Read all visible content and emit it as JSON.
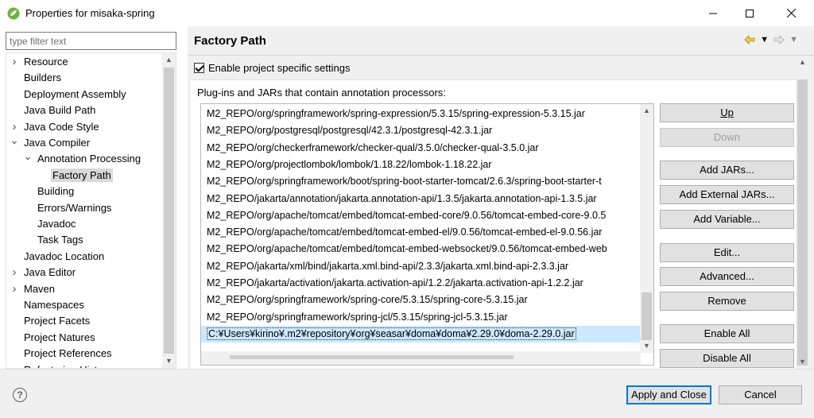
{
  "window": {
    "title": "Properties for misaka-spring",
    "minimize_icon": "minimize-icon",
    "maximize_icon": "maximize-icon",
    "close_icon": "close-icon"
  },
  "filter": {
    "placeholder": "type filter text"
  },
  "tree": {
    "items": [
      {
        "label": "Resource",
        "level": 0,
        "arrow": "right"
      },
      {
        "label": "Builders",
        "level": 0,
        "arrow": ""
      },
      {
        "label": "Deployment Assembly",
        "level": 0,
        "arrow": ""
      },
      {
        "label": "Java Build Path",
        "level": 0,
        "arrow": ""
      },
      {
        "label": "Java Code Style",
        "level": 0,
        "arrow": "right"
      },
      {
        "label": "Java Compiler",
        "level": 0,
        "arrow": "down"
      },
      {
        "label": "Annotation Processing",
        "level": 1,
        "arrow": "down"
      },
      {
        "label": "Factory Path",
        "level": 2,
        "arrow": "",
        "selected": true
      },
      {
        "label": "Building",
        "level": 1,
        "arrow": ""
      },
      {
        "label": "Errors/Warnings",
        "level": 1,
        "arrow": ""
      },
      {
        "label": "Javadoc",
        "level": 1,
        "arrow": ""
      },
      {
        "label": "Task Tags",
        "level": 1,
        "arrow": ""
      },
      {
        "label": "Javadoc Location",
        "level": 0,
        "arrow": ""
      },
      {
        "label": "Java Editor",
        "level": 0,
        "arrow": "right"
      },
      {
        "label": "Maven",
        "level": 0,
        "arrow": "right"
      },
      {
        "label": "Namespaces",
        "level": 0,
        "arrow": ""
      },
      {
        "label": "Project Facets",
        "level": 0,
        "arrow": ""
      },
      {
        "label": "Project Natures",
        "level": 0,
        "arrow": ""
      },
      {
        "label": "Project References",
        "level": 0,
        "arrow": ""
      },
      {
        "label": "Refactoring History",
        "level": 0,
        "arrow": ""
      }
    ]
  },
  "page": {
    "title": "Factory Path",
    "enable_label": "Enable project specific settings",
    "enable_checked": true,
    "section_label": "Plug-ins and JARs that contain annotation processors:"
  },
  "jars": [
    "M2_REPO/org/springframework/spring-expression/5.3.15/spring-expression-5.3.15.jar",
    "M2_REPO/org/postgresql/postgresql/42.3.1/postgresql-42.3.1.jar",
    "M2_REPO/org/checkerframework/checker-qual/3.5.0/checker-qual-3.5.0.jar",
    "M2_REPO/org/projectlombok/lombok/1.18.22/lombok-1.18.22.jar",
    "M2_REPO/org/springframework/boot/spring-boot-starter-tomcat/2.6.3/spring-boot-starter-t",
    "M2_REPO/jakarta/annotation/jakarta.annotation-api/1.3.5/jakarta.annotation-api-1.3.5.jar",
    "M2_REPO/org/apache/tomcat/embed/tomcat-embed-core/9.0.56/tomcat-embed-core-9.0.5",
    "M2_REPO/org/apache/tomcat/embed/tomcat-embed-el/9.0.56/tomcat-embed-el-9.0.56.jar",
    "M2_REPO/org/apache/tomcat/embed/tomcat-embed-websocket/9.0.56/tomcat-embed-web",
    "M2_REPO/jakarta/xml/bind/jakarta.xml.bind-api/2.3.3/jakarta.xml.bind-api-2.3.3.jar",
    "M2_REPO/jakarta/activation/jakarta.activation-api/1.2.2/jakarta.activation-api-1.2.2.jar",
    "M2_REPO/org/springframework/spring-core/5.3.15/spring-core-5.3.15.jar",
    "M2_REPO/org/springframework/spring-jcl/5.3.15/spring-jcl-5.3.15.jar",
    "C:¥Users¥kirino¥.m2¥repository¥org¥seasar¥doma¥doma¥2.29.0¥doma-2.29.0.jar"
  ],
  "selected_jar_index": 13,
  "buttons": {
    "up": "Up",
    "down": "Down",
    "add_jars": "Add JARs...",
    "add_external_jars": "Add External JARs...",
    "add_variable": "Add Variable...",
    "edit": "Edit...",
    "advanced": "Advanced...",
    "remove": "Remove",
    "enable_all": "Enable All",
    "disable_all": "Disable All"
  },
  "footer": {
    "help_glyph": "?",
    "apply_close": "Apply and Close",
    "cancel": "Cancel"
  },
  "colors": {
    "accent": "#0078d7",
    "selection": "#cce8ff",
    "window_bg": "#f0f0f0"
  }
}
